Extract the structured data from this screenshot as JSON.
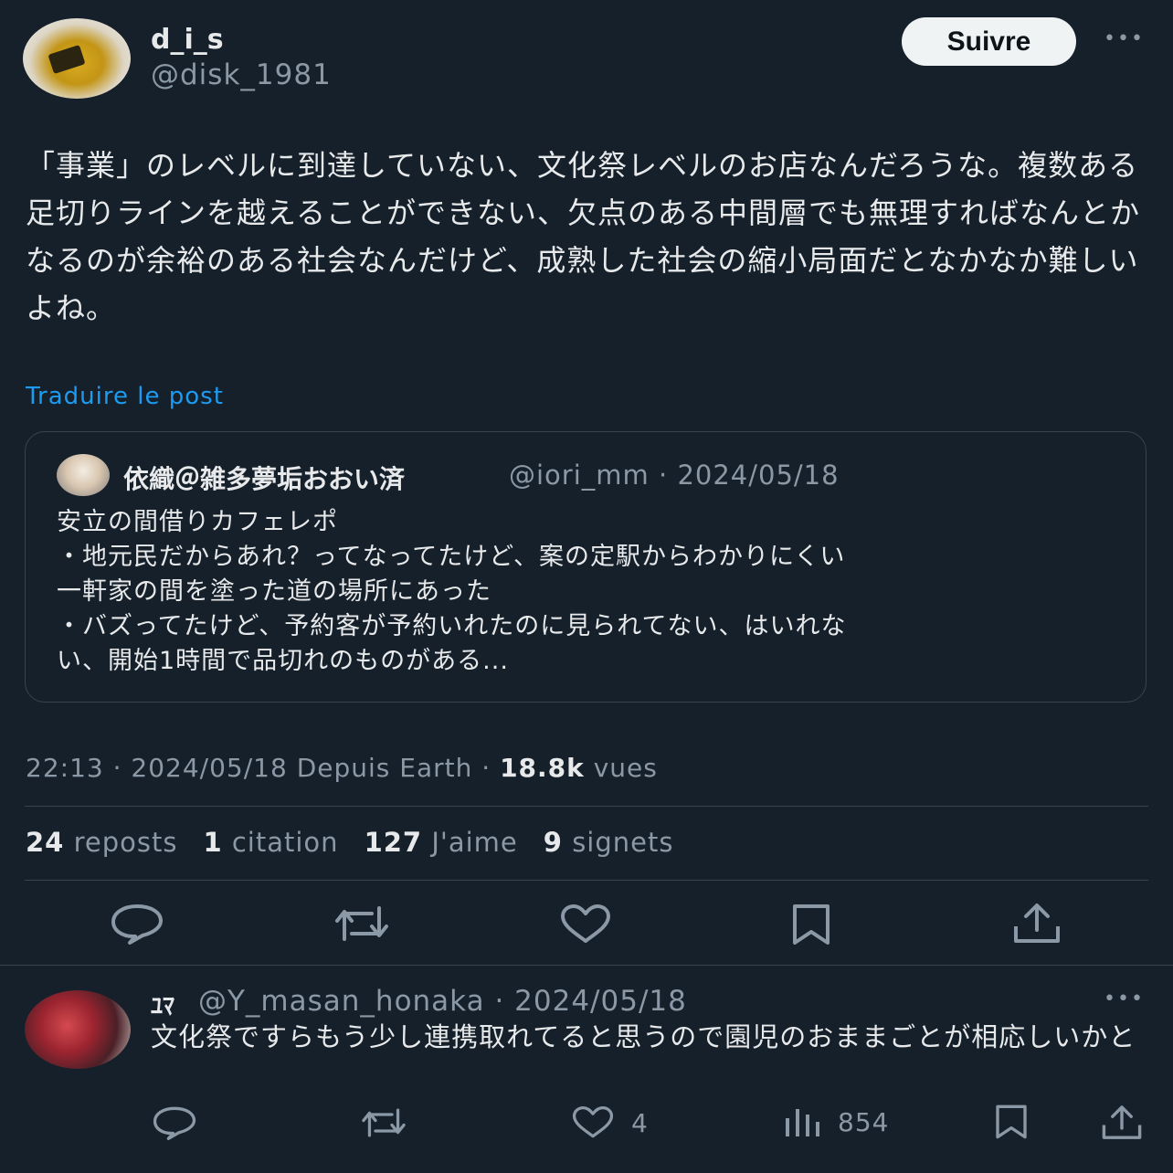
{
  "author": {
    "display_name": "d_i_s",
    "handle": "@disk_1981",
    "follow_label": "Suivre",
    "avatar_icon": "game-console-avatar"
  },
  "post": {
    "text": "「事業」のレベルに到達していない、文化祭レベルのお店なんだろうな。複数ある足切りラインを越えることができない、欠点のある中間層でも無理すればなんとかなるのが余裕のある社会なんだけど、成熟した社会の縮小局面だとなかなか難しいよね。",
    "translate_label": "Traduire le post",
    "time": "22:13",
    "date": "2024/05/18",
    "source": "Depuis Earth",
    "views": "18.8k",
    "views_label": "vues"
  },
  "quoted": {
    "display_name": "依織＠雑多夢垢おおい済",
    "handle": "@iori_mm",
    "date": "2024/05/18",
    "lines": [
      "安立の間借りカフェレポ",
      "・地元民だからあれ？ってなってたけど、案の定駅からわかりにくい",
      "一軒家の間を塗った道の場所にあった",
      "・バズってたけど、予約客が予約いれたのに見られてない、はいれな",
      "い、開始1時間で品切れのものがある..."
    ]
  },
  "stats": [
    {
      "count": "24",
      "label": "reposts"
    },
    {
      "count": "1",
      "label": "citation"
    },
    {
      "count": "127",
      "label": "J'aime"
    },
    {
      "count": "9",
      "label": "signets"
    }
  ],
  "reply": {
    "display_name": "ﾕﾏ",
    "handle": "@Y_masan_honaka",
    "date": "2024/05/18",
    "text": "文化祭ですらもう少し連携取れてると思うので園児のおままごとが相応しいかと",
    "likes": "4",
    "views": "854"
  },
  "icons": {
    "reply": "speech-bubble",
    "repost": "repost-arrows",
    "like": "heart",
    "bookmark": "bookmark",
    "share": "share-upload",
    "views": "bar-chart",
    "more": "three-dots"
  },
  "colors": {
    "background": "#15202b",
    "text": "#e7e9ea",
    "muted": "#8b98a5",
    "link": "#1d9bf0",
    "border": "#38444d"
  }
}
